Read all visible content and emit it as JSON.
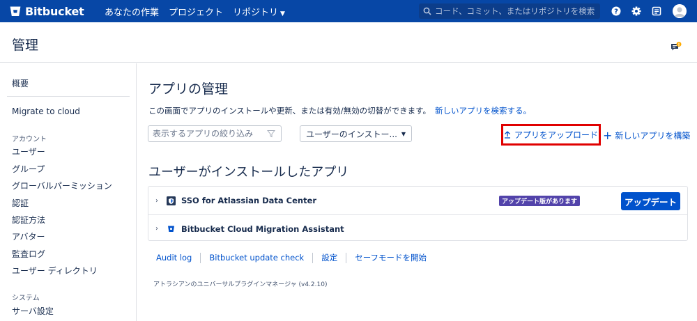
{
  "topnav": {
    "logo_text": "Bitbucket",
    "items": [
      {
        "label": "あなたの作業"
      },
      {
        "label": "プロジェクト"
      },
      {
        "label": "リポジトリ"
      }
    ],
    "search_placeholder": "コード、コミット、またはリポジトリを検索",
    "icons": [
      "search-icon",
      "help-icon",
      "settings-icon",
      "inbox-icon",
      "avatar"
    ],
    "brand_color": "#0747a6"
  },
  "header": {
    "title": "管理",
    "notification_badge": "!"
  },
  "sidebar": {
    "top_items": [
      "概要",
      "Migrate to cloud"
    ],
    "account_heading": "アカウント",
    "account_items": [
      "ユーザー",
      "グループ",
      "グローバルパーミッション",
      "認証",
      "認証方法",
      "アバター",
      "監査ログ",
      "ユーザー ディレクトリ"
    ],
    "system_heading": "システム",
    "system_items": [
      "サーバ設定"
    ]
  },
  "main": {
    "title": "アプリの管理",
    "description": "この画面でアプリのインストールや更新、または有効/無効の切替ができます。",
    "search_apps_link": "新しいアプリを検索する。",
    "filter_placeholder": "表示するアプリの絞り込み",
    "select_value": "ユーザーのインストー...",
    "upload_label": "アプリをアップロード",
    "build_label": "新しいアプリを構築",
    "section_title": "ユーザーがインストールしたアプリ",
    "apps": [
      {
        "name": "SSO for Atlassian Data Center",
        "badge": "アップデート版があります",
        "button": "アップデート"
      },
      {
        "name": "Bitbucket Cloud Migration Assistant"
      }
    ],
    "footer_links": [
      "Audit log",
      "Bitbucket update check",
      "設定",
      "セーフモードを開始"
    ],
    "version": "アトラシアンのユニバーサルプラグインマネージャ (v4.2.10)"
  }
}
